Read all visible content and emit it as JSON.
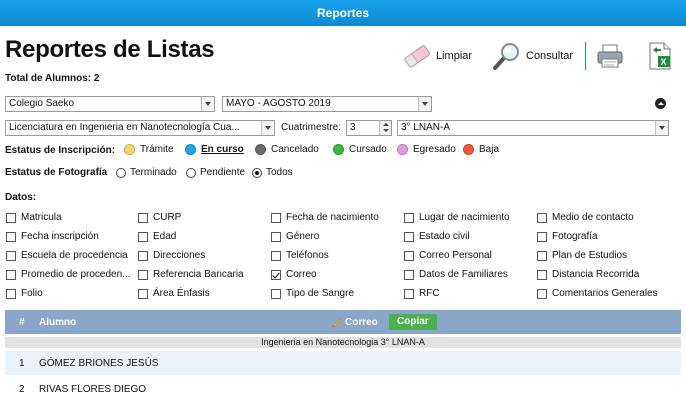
{
  "header": {
    "title": "Reportes"
  },
  "page": {
    "title": "Reportes de Listas",
    "total_label": "Total de Alumnos:",
    "total_value": "2"
  },
  "toolbar": {
    "clear_label": "Limpiar",
    "query_label": "Consultar"
  },
  "filters": {
    "school": "Colegio Saeko",
    "period": "MAYO - AGOSTO 2019",
    "career": "Licenciatura en Ingenieria en Nanotecnología Cua...",
    "quarter_label": "Cuatrimestre:",
    "quarter_value": "3",
    "group": "3° LNAN-A"
  },
  "inscription": {
    "label": "Estatus de Inscripción:",
    "options": [
      {
        "label": "Trámite",
        "color": "#f5d76e"
      },
      {
        "label": "En curso",
        "color": "#1ea7f0",
        "selected": true
      },
      {
        "label": "Cancelado",
        "color": "#6b6b6b"
      },
      {
        "label": "Cursado",
        "color": "#3ab83a"
      },
      {
        "label": "Egresado",
        "color": "#e79be3"
      },
      {
        "label": "Baja",
        "color": "#f0573f"
      }
    ]
  },
  "photo": {
    "label": "Estatus de Fotografía",
    "options": [
      {
        "label": "Terminado"
      },
      {
        "label": "Pendiente"
      },
      {
        "label": "Todos",
        "checked": true
      }
    ]
  },
  "datos": {
    "label": "Datos:",
    "columns": [
      [
        "Matricula",
        "Fecha inscripción",
        "Escuela de procedencia",
        "Promedio de proceden...",
        "Folio"
      ],
      [
        "CURP",
        "Edad",
        "Direcciones",
        "Referencia Bancaria",
        "Área Énfasis"
      ],
      [
        "Fecha de nacimiento",
        "Género",
        "Teléfonos",
        "Correo",
        "Tipo de Sangre"
      ],
      [
        "Lugar de nacimiento",
        "Estado civil",
        "Correo Personal",
        "Datos de Familiares",
        "RFC"
      ],
      [
        "Medio de contacto",
        "Fotografía",
        "Plan de Estudios",
        "Distancia Recorrida",
        "Comentarios Generales"
      ]
    ],
    "checked": [
      "Correo"
    ]
  },
  "table": {
    "headers": {
      "num": "#",
      "student": "Alumno",
      "email": "Correo",
      "copy": "Copiar"
    },
    "group_label": "Ingenieria en Nanotecnologia 3° LNAN-A",
    "rows": [
      {
        "num": "1",
        "name": "GÓMEZ BRIONES JESÚS"
      },
      {
        "num": "2",
        "name": "RIVAS FLORES DIEGO"
      }
    ]
  }
}
